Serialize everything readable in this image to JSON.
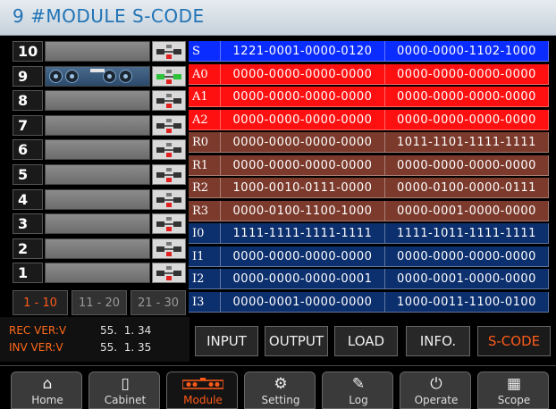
{
  "title": "9 #MODULE S-CODE",
  "modules": [
    {
      "num": "10",
      "active": false
    },
    {
      "num": "9",
      "active": true
    },
    {
      "num": "8",
      "active": false
    },
    {
      "num": "7",
      "active": false
    },
    {
      "num": "6",
      "active": false
    },
    {
      "num": "5",
      "active": false
    },
    {
      "num": "4",
      "active": false
    },
    {
      "num": "3",
      "active": false
    },
    {
      "num": "2",
      "active": false
    },
    {
      "num": "1",
      "active": false
    }
  ],
  "page_tabs": [
    {
      "label": "1 - 10",
      "active": true
    },
    {
      "label": "11 - 20",
      "active": false
    },
    {
      "label": "21 - 30",
      "active": false
    }
  ],
  "codes": [
    {
      "label": "S",
      "v1": "1221-0001-0000-0120",
      "v2": "0000-0000-1102-1000",
      "color": "#0a2cff"
    },
    {
      "label": "A0",
      "v1": "0000-0000-0000-0000",
      "v2": "0000-0000-0000-0000",
      "color": "#ff1010"
    },
    {
      "label": "A1",
      "v1": "0000-0000-0000-0000",
      "v2": "0000-0000-0000-0000",
      "color": "#ff1010"
    },
    {
      "label": "A2",
      "v1": "0000-0000-0000-0000",
      "v2": "0000-0000-0000-0000",
      "color": "#ff1010"
    },
    {
      "label": "R0",
      "v1": "0000-0000-0000-0000",
      "v2": "1011-1101-1111-1111",
      "color": "#7b3a2c"
    },
    {
      "label": "R1",
      "v1": "0000-0000-0000-0000",
      "v2": "0000-0000-0000-0000",
      "color": "#7b3a2c"
    },
    {
      "label": "R2",
      "v1": "1000-0010-0111-0000",
      "v2": "0000-0100-0000-0111",
      "color": "#7b3a2c"
    },
    {
      "label": "R3",
      "v1": "0000-0100-1100-1000",
      "v2": "0000-0001-0000-0000",
      "color": "#7b3a2c"
    },
    {
      "label": "I0",
      "v1": "1111-1111-1111-1111",
      "v2": "1111-1011-1111-1111",
      "color": "#0c2f6e"
    },
    {
      "label": "I1",
      "v1": "0000-0000-0000-0000",
      "v2": "0000-0000-0000-0000",
      "color": "#0c2f6e"
    },
    {
      "label": "I2",
      "v1": "0000-0000-0000-0001",
      "v2": "0000-0001-0000-0000",
      "color": "#0c2f6e"
    },
    {
      "label": "I3",
      "v1": "0000-0001-0000-0000",
      "v2": "1000-0011-1100-0100",
      "color": "#0c2f6e"
    }
  ],
  "versions": {
    "rec_label": "REC VER:V",
    "rec_value": "55.  1. 34",
    "inv_label": "INV VER:V",
    "inv_value": "55.  1. 35"
  },
  "function_buttons": [
    {
      "label": "INPUT",
      "active": false
    },
    {
      "label": "OUTPUT",
      "active": false
    },
    {
      "label": "LOAD",
      "active": false
    },
    {
      "label": "INFO.",
      "active": false
    },
    {
      "label": "S-CODE",
      "active": true
    }
  ],
  "nav": [
    {
      "label": "Home",
      "icon": "home-icon",
      "glyph": "⌂",
      "active": false
    },
    {
      "label": "Cabinet",
      "icon": "cabinet-icon",
      "glyph": "▯",
      "active": false
    },
    {
      "label": "Module",
      "icon": "module-icon",
      "glyph": "",
      "active": true
    },
    {
      "label": "Setting",
      "icon": "gears-icon",
      "glyph": "⚙",
      "active": false
    },
    {
      "label": "Log",
      "icon": "log-icon",
      "glyph": "✎",
      "active": false
    },
    {
      "label": "Operate",
      "icon": "power-icon",
      "glyph": "⏻",
      "active": false
    },
    {
      "label": "Scope",
      "icon": "scope-icon",
      "glyph": "▦",
      "active": false
    }
  ],
  "colors": {
    "accent": "#ff5a1a",
    "title": "#1f73b6"
  }
}
